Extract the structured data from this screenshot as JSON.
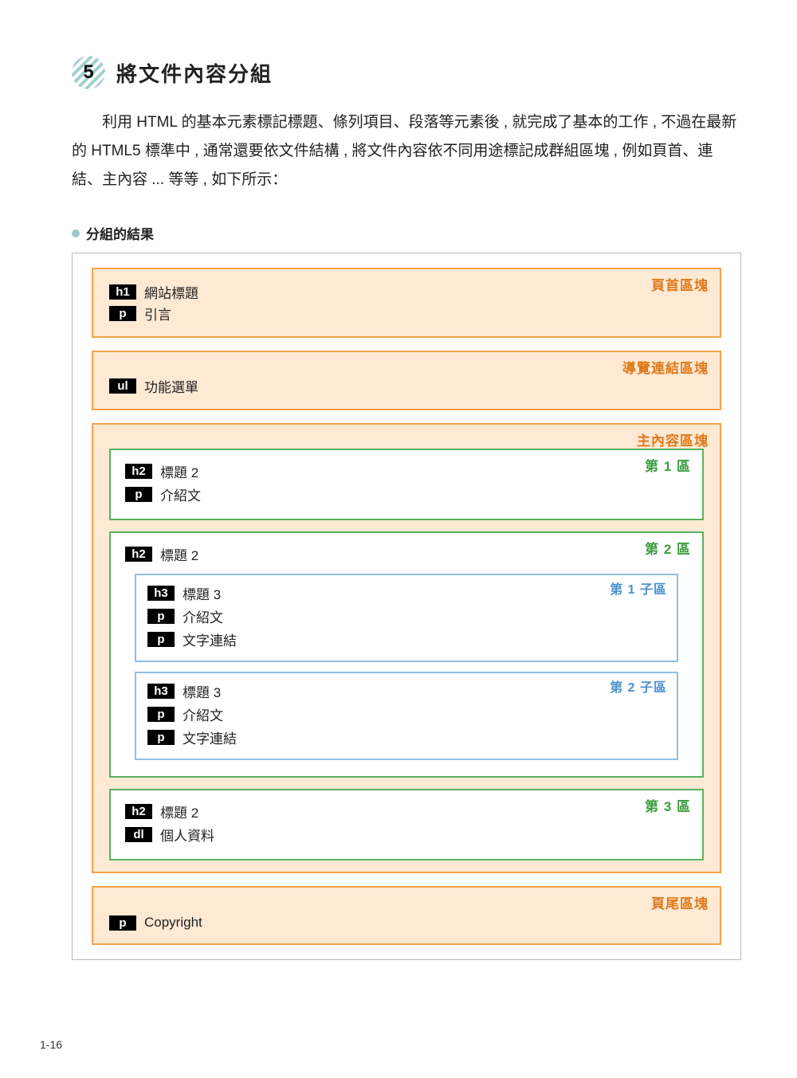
{
  "section": {
    "number": "5",
    "title": "將文件內容分組"
  },
  "intro_text": "利用 HTML 的基本元素標記標題、條列項目、段落等元素後 , 就完成了基本的工作 , 不過在最新的 HTML5 標準中 , 通常還要依文件結構 , 將文件內容依不同用途標記成群組區塊 , 例如頁首、連結、主內容 ... 等等 , 如下所示：",
  "sub_heading": "分組的結果",
  "blocks": {
    "header": {
      "label": "頁首區塊",
      "items": [
        {
          "tag": "h1",
          "text": "網站標題"
        },
        {
          "tag": "p",
          "text": "引言"
        }
      ]
    },
    "nav": {
      "label": "導覽連結區塊",
      "items": [
        {
          "tag": "ul",
          "text": "功能選單"
        }
      ]
    },
    "main": {
      "label": "主內容區塊",
      "sections": [
        {
          "label": "第 1 區",
          "items": [
            {
              "tag": "h2",
              "text": "標題 2"
            },
            {
              "tag": "p",
              "text": "介紹文"
            }
          ]
        },
        {
          "label": "第 2 區",
          "head": {
            "tag": "h2",
            "text": "標題 2"
          },
          "subs": [
            {
              "label": "第 1 子區",
              "items": [
                {
                  "tag": "h3",
                  "text": "標題 3"
                },
                {
                  "tag": "p",
                  "text": "介紹文"
                },
                {
                  "tag": "p",
                  "text": "文字連結"
                }
              ]
            },
            {
              "label": "第 2 子區",
              "items": [
                {
                  "tag": "h3",
                  "text": "標題 3"
                },
                {
                  "tag": "p",
                  "text": "介紹文"
                },
                {
                  "tag": "p",
                  "text": "文字連結"
                }
              ]
            }
          ]
        },
        {
          "label": "第 3 區",
          "items": [
            {
              "tag": "h2",
              "text": "標題 2"
            },
            {
              "tag": "dl",
              "text": "個人資料"
            }
          ]
        }
      ]
    },
    "footer": {
      "label": "頁尾區塊",
      "items": [
        {
          "tag": "p",
          "text": "Copyright"
        }
      ]
    }
  },
  "page_number": "1-16"
}
